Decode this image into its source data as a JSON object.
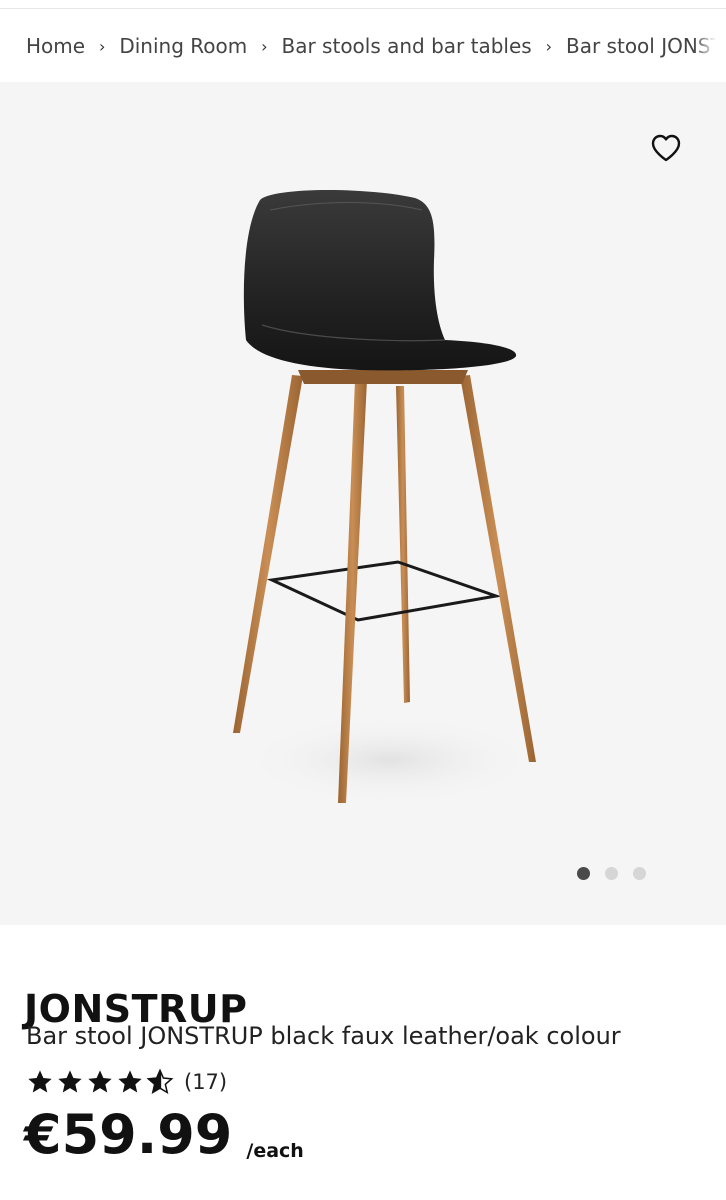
{
  "breadcrumb": {
    "items": [
      "Home",
      "Dining Room",
      "Bar stools and bar tables"
    ],
    "current": "Bar stool JONSTRUP"
  },
  "gallery": {
    "favorite_icon": "heart-outline-icon",
    "image_count": 3,
    "active_index": 0
  },
  "product": {
    "name": "JONSTRUP",
    "description": "Bar stool JONSTRUP black faux leather/oak colour",
    "rating": 4.5,
    "review_count": "(17)",
    "price": "€59.99",
    "price_unit": "/each"
  }
}
